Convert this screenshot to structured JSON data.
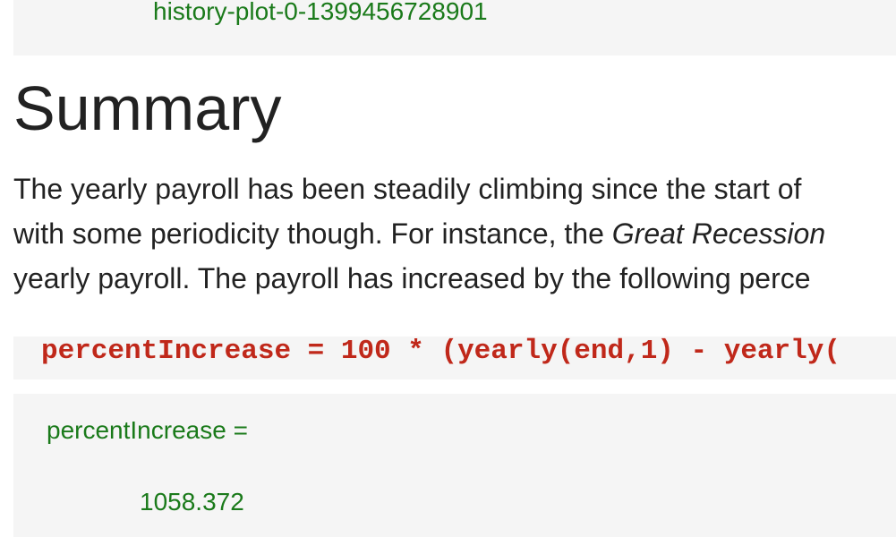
{
  "top_output": {
    "text": "history-plot-0-1399456728901"
  },
  "summary": {
    "heading": "Summary",
    "lines": [
      {
        "text": "The yearly payroll has been steadily climbing since the start of"
      },
      {
        "before": "with some periodicity though. For instance, the ",
        "emphasis": "Great Recession"
      },
      {
        "text": "yearly payroll. The payroll has increased by the following perce"
      }
    ]
  },
  "code": {
    "line": "percentIncrease = 100 * (yearly(end,1) - yearly("
  },
  "result": {
    "label": "percentIncrease =",
    "value": "1058.372"
  },
  "colors": {
    "code_text": "#c0281a",
    "output_text": "#1a7a1a",
    "block_background": "#f5f5f5",
    "body_text": "#222222"
  }
}
